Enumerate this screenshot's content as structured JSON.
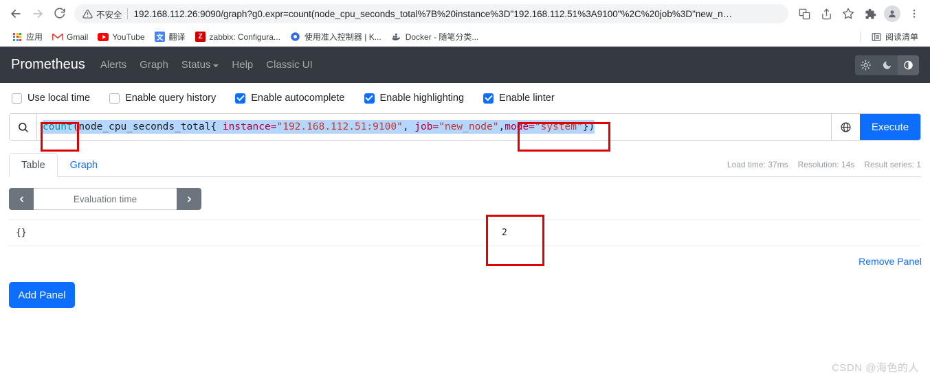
{
  "browser": {
    "back_icon": "back-arrow-icon",
    "forward_icon": "forward-arrow-icon",
    "reload_icon": "reload-icon",
    "security_warning": "不安全",
    "url": "192.168.112.26:9090/graph?g0.expr=count(node_cpu_seconds_total%7B%20instance%3D\"192.168.112.51%3A9100\"%2C%20job%3D\"new_n…",
    "toolbar_icons": [
      "translate-icon",
      "share-icon",
      "bookmark-star-icon",
      "extensions-puzzle-icon",
      "profile-avatar-icon",
      "more-menu-icon"
    ],
    "bookmarks": [
      {
        "label": "应用",
        "icon": "apps-grid-icon",
        "color": "#4285f4"
      },
      {
        "label": "Gmail",
        "icon": "gmail-icon",
        "color": "#ea4335"
      },
      {
        "label": "YouTube",
        "icon": "youtube-icon",
        "color": "#ff0000"
      },
      {
        "label": "翻译",
        "icon": "translate-icon",
        "color": "#4285f4"
      },
      {
        "label": "zabbix: Configura...",
        "icon": "zabbix-icon",
        "color": "#d40000"
      },
      {
        "label": "使用准入控制器 | K...",
        "icon": "kubernetes-icon",
        "color": "#326ce5"
      },
      {
        "label": "Docker - 随笔分类...",
        "icon": "docker-icon",
        "color": "#2496ed"
      }
    ],
    "reading_list": {
      "label": "阅读清单",
      "icon": "reading-list-icon"
    }
  },
  "nav": {
    "brand": "Prometheus",
    "links": [
      {
        "label": "Alerts",
        "has_caret": false
      },
      {
        "label": "Graph",
        "has_caret": false
      },
      {
        "label": "Status",
        "has_caret": true
      },
      {
        "label": "Help",
        "has_caret": false
      },
      {
        "label": "Classic UI",
        "has_caret": false
      }
    ],
    "theme_buttons": [
      {
        "name": "light-theme-button",
        "icon": "sun-icon",
        "active": false
      },
      {
        "name": "dark-theme-button",
        "icon": "moon-icon",
        "active": false
      },
      {
        "name": "auto-theme-button",
        "icon": "half-circle-icon",
        "active": true
      }
    ]
  },
  "options": [
    {
      "label": "Use local time",
      "checked": false
    },
    {
      "label": "Enable query history",
      "checked": false
    },
    {
      "label": "Enable autocomplete",
      "checked": true
    },
    {
      "label": "Enable highlighting",
      "checked": true
    },
    {
      "label": "Enable linter",
      "checked": true
    }
  ],
  "query": {
    "search_icon": "search-icon",
    "globe_icon": "globe-icon",
    "execute_label": "Execute",
    "expression_full": "count(node_cpu_seconds_total{ instance=\"192.168.112.51:9100\", job=\"new_node\",mode=\"system\"})",
    "tokens": {
      "fn": "count",
      "open_metric": "(node_cpu_seconds_total{ ",
      "lbl_instance": "instance=",
      "str_instance": "\"192.168.112.51:9100\"",
      "comma1": ", ",
      "lbl_job": "job=",
      "str_job": "\"new_node\"",
      "comma2": ",",
      "lbl_mode": "mode=",
      "str_mode": "\"system\"",
      "close": "})"
    }
  },
  "tabs": [
    {
      "label": "Table",
      "active": true
    },
    {
      "label": "Graph",
      "active": false
    }
  ],
  "stats": {
    "load_time": "Load time: 37ms",
    "resolution": "Resolution: 14s",
    "result_series": "Result series: 1"
  },
  "evaluation": {
    "prev_icon": "chevron-left-icon",
    "next_icon": "chevron-right-icon",
    "placeholder": "Evaluation time"
  },
  "result": {
    "rows": [
      {
        "metric": "{}",
        "value": "2"
      }
    ]
  },
  "actions": {
    "remove_panel": "Remove Panel",
    "add_panel": "Add Panel"
  },
  "watermark": "CSDN @海色的人",
  "colors": {
    "accent_blue": "#0d6efd",
    "nav_dark": "#343a40",
    "annotation_red": "#e00000",
    "selection_blue": "#b5d6fd"
  }
}
